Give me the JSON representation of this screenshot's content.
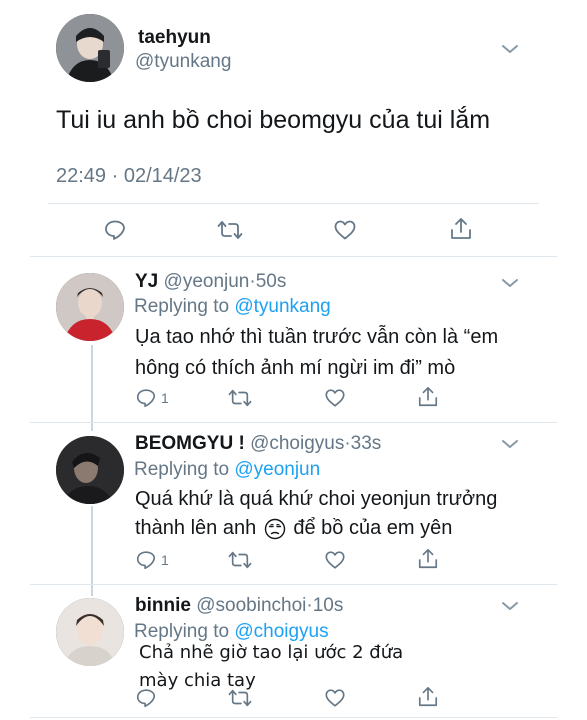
{
  "main_tweet": {
    "display_name": "taehyun",
    "handle": "@tyunkang",
    "text": "Tui iu anh bồ choi beomgyu của tui lắm",
    "timestamp": "22:49 · 02/14/23"
  },
  "replies": [
    {
      "display_name": "YJ",
      "handle": "@yeonjun",
      "time": "·50s",
      "replying_prefix": "Replying to ",
      "replying_to": "@tyunkang",
      "text_line1": "Ụa tao nhớ thì tuần trước vẫn còn là “em",
      "text_line2": "hông có thích ảnh mí ngừi im đi” mò",
      "reply_count": "1"
    },
    {
      "display_name": "BEOMGYU !",
      "handle": "@choigyus",
      "time": "·33s",
      "replying_prefix": "Replying to ",
      "replying_to": "@yeonjun",
      "text_line1": "Quá khứ là quá khứ choi yeonjun trưởng",
      "text_line2_a": "thành lên anh ",
      "text_line2_b": " để bồ của em yên",
      "reply_count": "1"
    },
    {
      "display_name": "binnie",
      "handle": "@soobinchoi",
      "time": "·10s",
      "replying_prefix": "Replying to ",
      "replying_to": "@choigyus",
      "text_line1": "Chả nhẽ giờ tao lại ước 2 đứa",
      "text_line2": "mày chia tay"
    }
  ],
  "colors": {
    "accent": "#1da1f2",
    "secondary_text": "#657786",
    "divider": "#e1e8ed"
  }
}
